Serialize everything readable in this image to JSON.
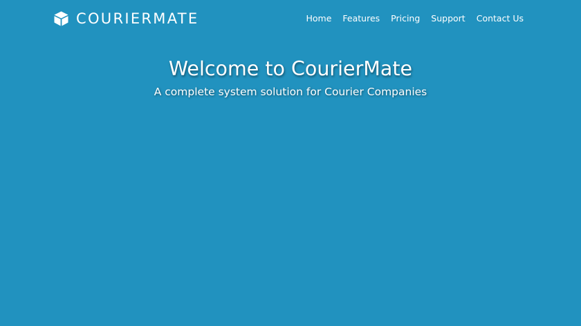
{
  "brand": {
    "name": "COURIERMATE",
    "icon": "cube-icon"
  },
  "nav": {
    "items": [
      {
        "label": "Home"
      },
      {
        "label": "Features"
      },
      {
        "label": "Pricing"
      },
      {
        "label": "Support"
      },
      {
        "label": "Contact Us"
      }
    ]
  },
  "hero": {
    "title": "Welcome to CourierMate",
    "subtitle": "A complete system solution for Courier Companies"
  },
  "colors": {
    "background": "#2192bf",
    "text": "#ffffff"
  }
}
